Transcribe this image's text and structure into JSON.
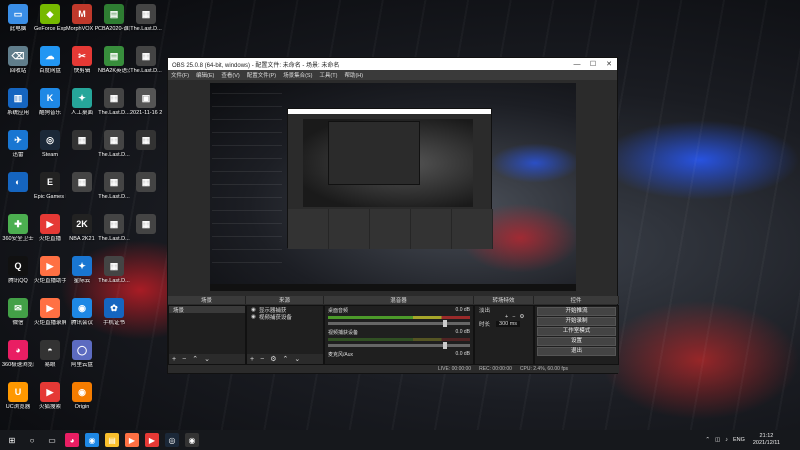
{
  "desktop": {
    "icons": [
      {
        "label": "此电脑",
        "color": "#3a8ee6",
        "glyph": "▭"
      },
      {
        "label": "GeForce Experience",
        "color": "#76b900",
        "glyph": "◆"
      },
      {
        "label": "MorphVOX Pro",
        "color": "#c0392b",
        "glyph": "M"
      },
      {
        "label": "CBA2020-谁家HAGL...",
        "color": "#2e7d32",
        "glyph": "▤"
      },
      {
        "label": "The.Last.D...",
        "color": "#444",
        "glyph": "▦"
      },
      {
        "label": "回收站",
        "color": "#607d8b",
        "glyph": "⌫"
      },
      {
        "label": "百度网盘",
        "color": "#2196f3",
        "glyph": "☁"
      },
      {
        "label": "快剪辑",
        "color": "#e53935",
        "glyph": "✂"
      },
      {
        "label": "NBA2K英语汉体辅助器",
        "color": "#388e3c",
        "glyph": "▤"
      },
      {
        "label": "The.Last.D...",
        "color": "#444",
        "glyph": "▦"
      },
      {
        "label": "系统应用",
        "color": "#1565c0",
        "glyph": "▥"
      },
      {
        "label": "酷狗音乐",
        "color": "#1e88e5",
        "glyph": "K"
      },
      {
        "label": "人工桌面",
        "color": "#26a69a",
        "glyph": "✦"
      },
      {
        "label": "The.Last.D...",
        "color": "#444",
        "glyph": "▦"
      },
      {
        "label": "2021-11-16 20-04-532...",
        "color": "#555",
        "glyph": "▣"
      },
      {
        "label": "迅雷",
        "color": "#1976d2",
        "glyph": "✈"
      },
      {
        "label": "Steam",
        "color": "#1b2838",
        "glyph": "◎"
      },
      {
        "label": "",
        "color": "#333",
        "glyph": "▦"
      },
      {
        "label": "The.Last.D...",
        "color": "#444",
        "glyph": "▦"
      },
      {
        "label": "",
        "color": "#333",
        "glyph": "▦"
      },
      {
        "label": "",
        "color": "#1565c0",
        "glyph": "◐"
      },
      {
        "label": "Epic Games Launcher",
        "color": "#222",
        "glyph": "E"
      },
      {
        "label": "",
        "color": "#444",
        "glyph": "▦"
      },
      {
        "label": "The.Last.D...",
        "color": "#444",
        "glyph": "▦"
      },
      {
        "label": "",
        "color": "#444",
        "glyph": "▦"
      },
      {
        "label": "360安全卫士",
        "color": "#4caf50",
        "glyph": "✚"
      },
      {
        "label": "火炬直播",
        "color": "#e53935",
        "glyph": "▶"
      },
      {
        "label": "NBA 2K21",
        "color": "#222",
        "glyph": "2K"
      },
      {
        "label": "The.Last.D...",
        "color": "#444",
        "glyph": "▦"
      },
      {
        "label": "",
        "color": "#444",
        "glyph": "▦"
      },
      {
        "label": "腾讯QQ",
        "color": "#111",
        "glyph": "Q"
      },
      {
        "label": "火炬直播助手",
        "color": "#ff7043",
        "glyph": "▶"
      },
      {
        "label": "星际云",
        "color": "#1976d2",
        "glyph": "✦"
      },
      {
        "label": "The.Last.D...",
        "color": "#444",
        "glyph": "▦"
      },
      {
        "label": "微信",
        "color": "#43a047",
        "glyph": "✉"
      },
      {
        "label": "火炬直播录屏",
        "color": "#ff7043",
        "glyph": "▶"
      },
      {
        "label": "腾讯会议",
        "color": "#1e88e5",
        "glyph": "◉"
      },
      {
        "label": "手机证书",
        "color": "#1565c0",
        "glyph": "✿"
      },
      {
        "label": "360极速浏览器",
        "color": "#e91e63",
        "glyph": "◕"
      },
      {
        "label": "易眼",
        "color": "#333",
        "glyph": "◓"
      },
      {
        "label": "阿里云盘",
        "color": "#5c6bc0",
        "glyph": "◯"
      },
      {
        "label": "UC浏览器",
        "color": "#ff9800",
        "glyph": "U"
      },
      {
        "label": "火狐搜索",
        "color": "#e53935",
        "glyph": "▶"
      },
      {
        "label": "Origin",
        "color": "#f57c00",
        "glyph": "◉"
      }
    ]
  },
  "obs": {
    "title": "OBS 25.0.8 (64-bit, windows) - 配置文件: 未命名 - 场景: 未命名",
    "menus": [
      "文件(F)",
      "编辑(E)",
      "查看(V)",
      "配置文件(P)",
      "场景集合(S)",
      "工具(T)",
      "帮助(H)"
    ],
    "docks": {
      "scenes_title": "场景",
      "sources_title": "来源",
      "mixer_title": "混音器",
      "transitions_title": "转场特效",
      "controls_title": "控件"
    },
    "scenes": [
      "场景"
    ],
    "sources": [
      "显示器捕获",
      "视频捕获设备"
    ],
    "mixer": [
      {
        "name": "桌面音频",
        "level": "0.0 dB"
      },
      {
        "name": "视频捕获设备",
        "level": "0.0 dB"
      },
      {
        "name": "麦克风/Aux",
        "level": "0.0 dB"
      }
    ],
    "transitions": {
      "type": "淡出",
      "duration_label": "时长",
      "duration_value": "300 ms"
    },
    "controls": [
      "开始推流",
      "开始录制",
      "工作室模式",
      "设置",
      "退出"
    ],
    "status": {
      "live": "LIVE: 00:00:00",
      "rec": "REC: 00:00:00",
      "cpu": "CPU: 2.4%, 60.00 fps"
    }
  },
  "taskbar": {
    "apps": [
      {
        "glyph": "⊞",
        "color": "#16181c"
      },
      {
        "glyph": "○",
        "color": "#16181c"
      },
      {
        "glyph": "▭",
        "color": "#16181c"
      },
      {
        "glyph": "◕",
        "color": "#e91e63"
      },
      {
        "glyph": "◉",
        "color": "#1e88e5"
      },
      {
        "glyph": "▤",
        "color": "#fbc02d"
      },
      {
        "glyph": "▶",
        "color": "#ff7043"
      },
      {
        "glyph": "▶",
        "color": "#e53935"
      },
      {
        "glyph": "◎",
        "color": "#1b2838"
      },
      {
        "glyph": "◉",
        "color": "#333"
      }
    ],
    "lang": "ENG",
    "time": "21:12",
    "date": "2021/12/11"
  }
}
